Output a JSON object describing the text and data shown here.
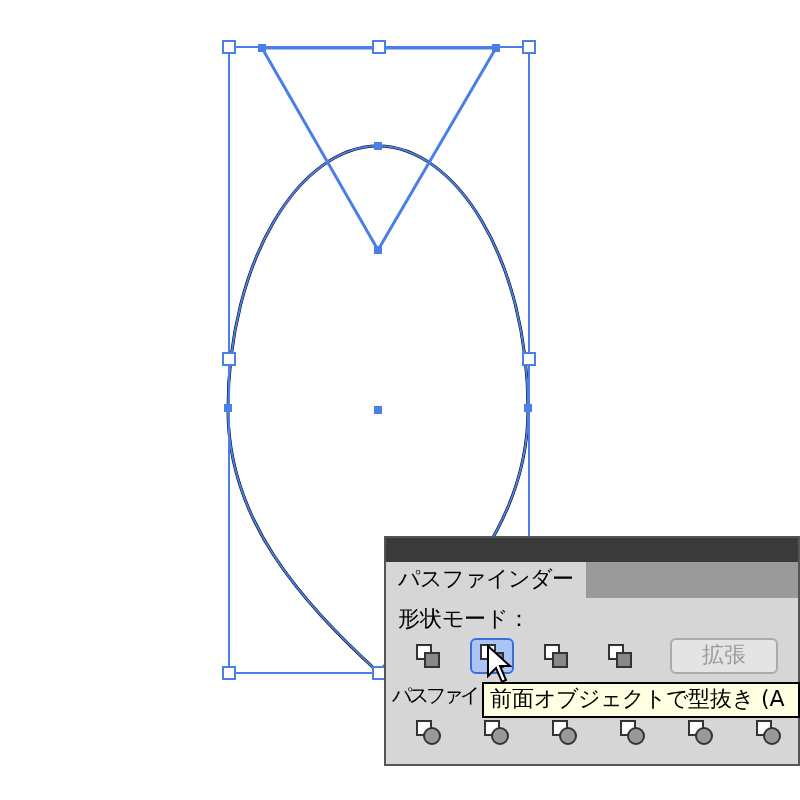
{
  "panel": {
    "tab": "パスファインダー",
    "shape_modes_label": "形状モード：",
    "shape_modes": [
      {
        "selected": false
      },
      {
        "selected": true
      },
      {
        "selected": false
      },
      {
        "selected": false
      }
    ],
    "expand_button": {
      "label": "拡張",
      "disabled": true
    },
    "pathfinders_label": "パスファイ",
    "pathfinders": [
      {
        "selected": false
      },
      {
        "selected": false
      },
      {
        "selected": false
      },
      {
        "selected": false
      },
      {
        "selected": false
      },
      {
        "selected": false
      }
    ]
  },
  "tooltip": "前面オブジェクトで型抜き (A"
}
